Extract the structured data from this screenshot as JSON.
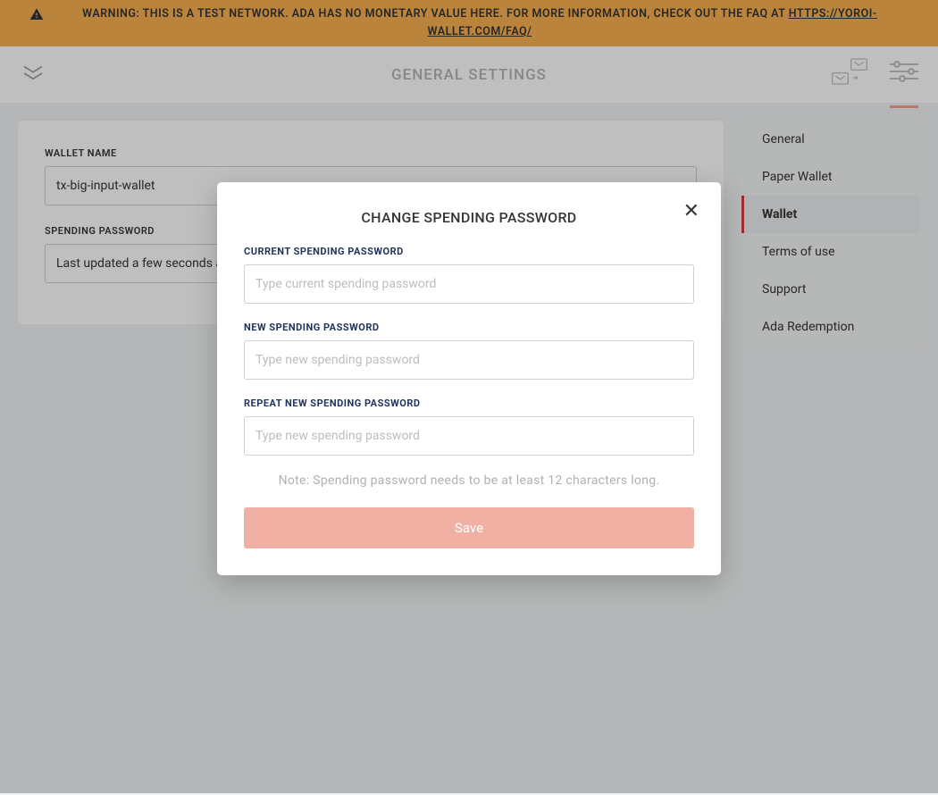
{
  "banner": {
    "text_prefix": "WARNING: THIS IS A TEST NETWORK. ADA HAS NO MONETARY VALUE HERE. FOR MORE INFORMATION, CHECK OUT THE FAQ AT",
    "link_text": "HTTPS://YOROI-WALLET.COM/FAQ/"
  },
  "header": {
    "title": "GENERAL SETTINGS"
  },
  "main": {
    "wallet_name_label": "WALLET NAME",
    "wallet_name_value": "tx-big-input-wallet",
    "spending_password_label": "SPENDING PASSWORD",
    "spending_password_value": "Last updated a few seconds ago"
  },
  "sidebar": {
    "items": [
      {
        "label": "General",
        "active": false
      },
      {
        "label": "Paper Wallet",
        "active": false
      },
      {
        "label": "Wallet",
        "active": true
      },
      {
        "label": "Terms of use",
        "active": false
      },
      {
        "label": "Support",
        "active": false
      },
      {
        "label": "Ada Redemption",
        "active": false
      }
    ]
  },
  "modal": {
    "title": "CHANGE SPENDING PASSWORD",
    "current_label": "CURRENT SPENDING PASSWORD",
    "current_placeholder": "Type current spending password",
    "new_label": "NEW SPENDING PASSWORD",
    "new_placeholder": "Type new spending password",
    "repeat_label": "REPEAT NEW SPENDING PASSWORD",
    "repeat_placeholder": "Type new spending password",
    "note": "Note: Spending password needs to be at least 12 characters long.",
    "save_label": "Save"
  }
}
